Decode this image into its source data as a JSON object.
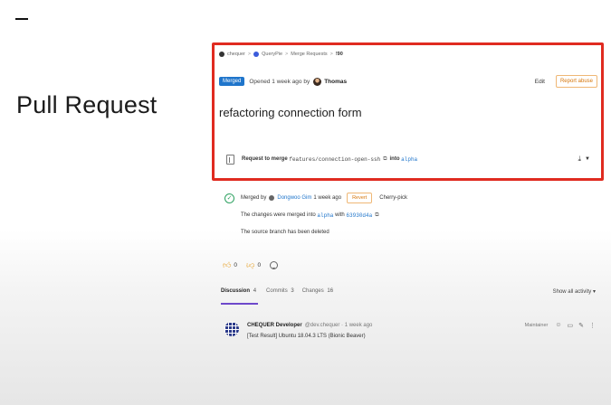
{
  "slide": {
    "title": "Pull Request"
  },
  "breadcrumb": {
    "items": [
      "chequer",
      "QueryPie",
      "Merge Requests",
      "!90"
    ]
  },
  "header": {
    "status_badge": "Merged",
    "opened_text": "Opened 1 week ago by",
    "author": "Thomas",
    "edit_label": "Edit",
    "report_label": "Report abuse"
  },
  "mr": {
    "title": "refactoring connection form",
    "request_prefix": "Request to merge",
    "source_branch": "features/connection-open-ssh",
    "into_text": "into",
    "target_branch": "alpha"
  },
  "merge_info": {
    "merged_by_text": "Merged by",
    "merger": "Dongwoo Gim",
    "merged_time": "1 week ago",
    "revert_label": "Revert",
    "cherry_pick_label": "Cherry-pick",
    "merged_into_text": "The changes were merged into",
    "merged_branch": "alpha",
    "with_text": "with",
    "commit_sha": "63930d4a",
    "deleted_text": "The source branch has been deleted"
  },
  "reactions": {
    "thumbs_up_count": "0",
    "thumbs_down_count": "0"
  },
  "tabs": {
    "items": [
      {
        "label": "Discussion",
        "count": "4"
      },
      {
        "label": "Commits",
        "count": "3"
      },
      {
        "label": "Changes",
        "count": "16"
      }
    ],
    "show_all": "Show all activity ▾"
  },
  "note": {
    "author": "CHEQUER Developer",
    "handle_time": "@dev.chequer · 1 week ago",
    "role": "Maintainer",
    "text": "[Test Result] Ubuntu 18.04.3 LTS (Bionic Beaver)"
  },
  "colors": {
    "highlight_border": "#e02b20",
    "merged_badge": "#1f75cb",
    "link": "#1f75cb",
    "warning_button": "#d6760b",
    "active_tab": "#6e49cb",
    "success": "#2da160"
  }
}
